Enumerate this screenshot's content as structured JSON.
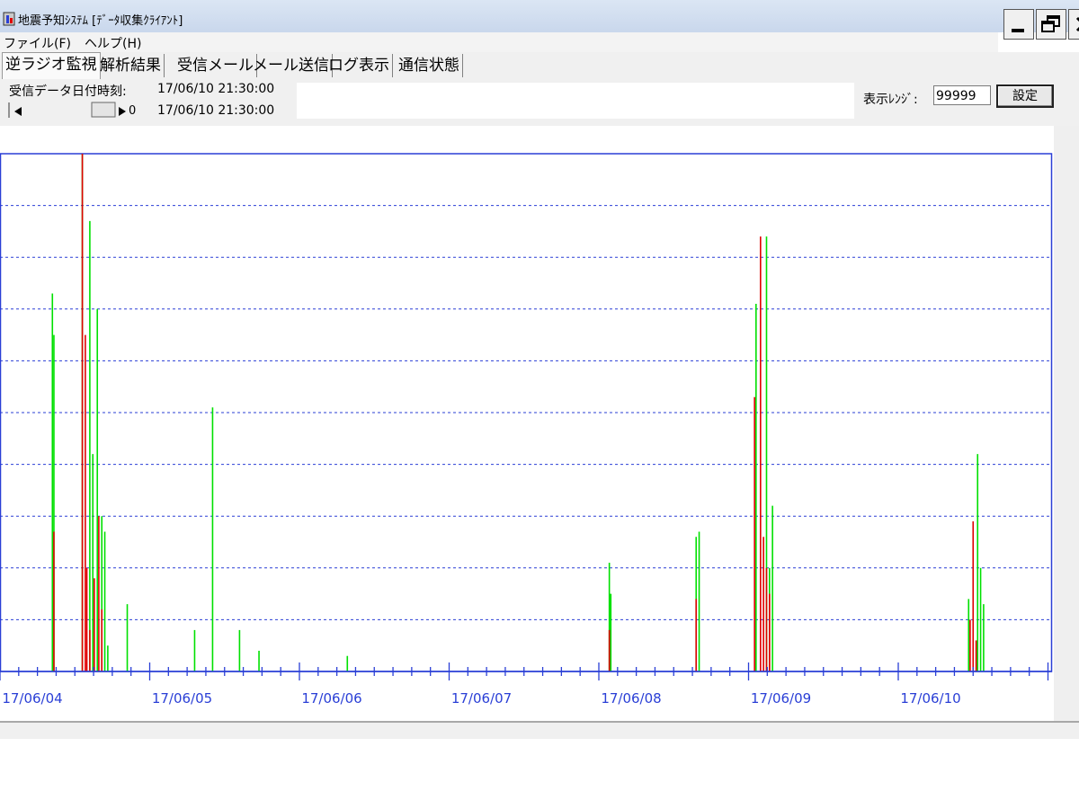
{
  "window": {
    "title": "地震予知ｼｽﾃﾑ [ﾃﾞｰﾀ収集ｸﾗｲｱﾝﾄ]",
    "buttons": [
      "minimize-icon",
      "restore-icon",
      "close-icon"
    ]
  },
  "menu": {
    "items": [
      "ファイル(F)",
      "ヘルプ(H)"
    ]
  },
  "tabs": [
    {
      "label": "逆ラジオ監視",
      "active": true
    },
    {
      "label": "解析結果",
      "active": false
    },
    {
      "label": "受信メール",
      "active": false
    },
    {
      "label": "メール送信",
      "active": false
    },
    {
      "label": "ログ表示",
      "active": false
    },
    {
      "label": "通信状態",
      "active": false
    }
  ],
  "controls": {
    "received_label": "受信データ日付時刻:",
    "received_datetime": "17/06/10 21:30:00",
    "current_datetime": "17/06/10 21:30:00",
    "scroll_value": "0",
    "range_label": "表示ﾚﾝｼﾞ:",
    "range_value": "99999",
    "set_button": "設定"
  },
  "chart_data": {
    "type": "bar",
    "x_tick_labels": [
      "17/06/04",
      "17/06/05",
      "17/06/06",
      "17/06/07",
      "17/06/08",
      "17/06/09",
      "17/06/10"
    ],
    "ylim": [
      0,
      99999
    ],
    "grid": true,
    "colors": {
      "frame": "#2a3fd6",
      "grid": "#2a3fd6",
      "axis": "#2a3fd6",
      "green": "#00e000",
      "red": "#e00000"
    },
    "series": [
      {
        "color": "green",
        "x": [
          0.35,
          0.36,
          0.55,
          0.6,
          0.62,
          0.65,
          0.68,
          0.7,
          0.72,
          0.85,
          1.3,
          1.42,
          1.6,
          1.73,
          2.32,
          4.07,
          4.08,
          4.65,
          4.67,
          5.05,
          5.12,
          5.14,
          5.16,
          6.47,
          6.53,
          6.55,
          6.57
        ],
        "values": [
          73000,
          65000,
          99999,
          87000,
          42000,
          70000,
          30000,
          27000,
          5000,
          13000,
          8000,
          51000,
          8000,
          4000,
          3000,
          21000,
          15000,
          26000,
          27000,
          71000,
          84000,
          20000,
          32000,
          14000,
          42000,
          20000,
          13000
        ]
      },
      {
        "color": "red",
        "x": [
          0.36,
          0.55,
          0.57,
          0.58,
          0.6,
          0.63,
          0.66,
          0.68,
          4.07,
          4.65,
          5.04,
          5.08,
          5.1,
          5.12,
          5.14,
          6.48,
          6.5,
          6.52
        ],
        "values": [
          27000,
          99999,
          65000,
          20000,
          8000,
          18000,
          30000,
          12000,
          8000,
          14000,
          53000,
          84000,
          26000,
          20000,
          15000,
          10000,
          29000,
          6000
        ]
      }
    ]
  }
}
